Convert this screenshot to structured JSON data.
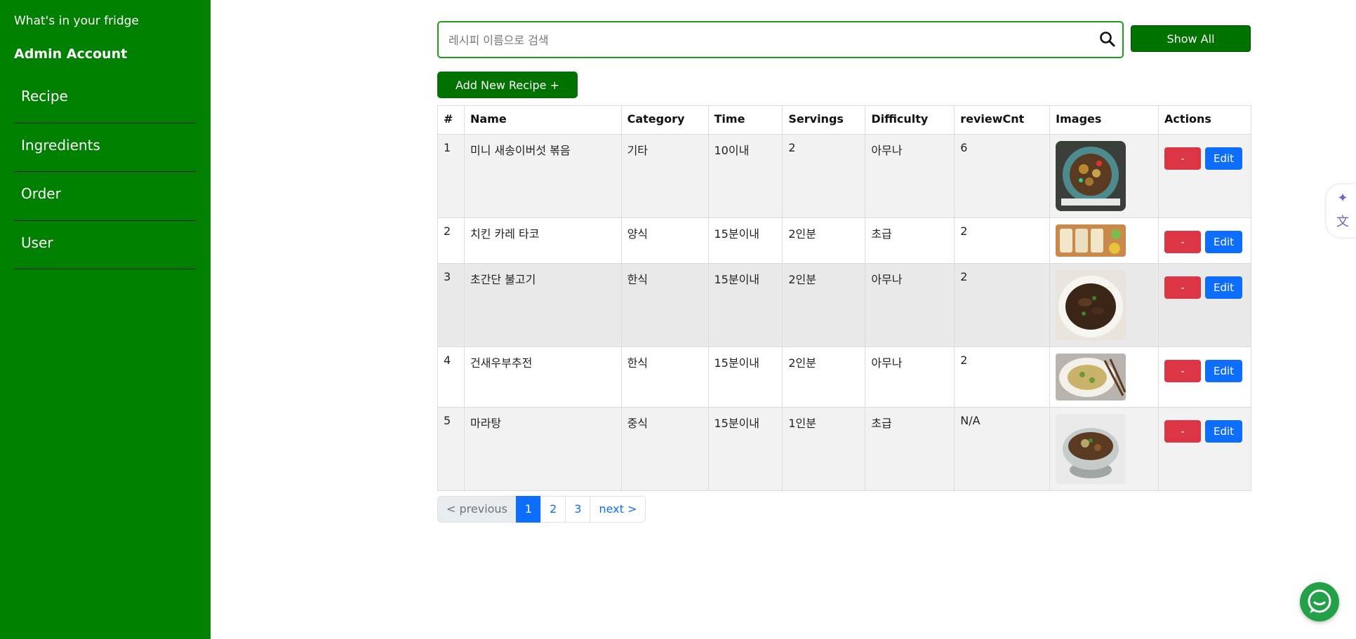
{
  "sidebar": {
    "brand": "What's in your fridge",
    "account": "Admin Account",
    "items": [
      {
        "label": "Recipe"
      },
      {
        "label": "Ingredients"
      },
      {
        "label": "Order"
      },
      {
        "label": "User"
      }
    ]
  },
  "search": {
    "placeholder": "레시피 이름으로 검색",
    "value": "",
    "icon": "search-icon"
  },
  "toolbar": {
    "show_all_label": "Show All",
    "add_label": "Add New Recipe +"
  },
  "table": {
    "columns": [
      "#",
      "Name",
      "Category",
      "Time",
      "Servings",
      "Difficulty",
      "reviewCnt",
      "Images",
      "Actions"
    ],
    "rows": [
      {
        "num": "1",
        "name": "미니 새송이버섯 볶음",
        "category": "기타",
        "time": "10이내",
        "servings": "2",
        "difficulty": "아무나",
        "reviewCnt": "6",
        "image_alt": "미니 새송이버섯 볶음 이미지"
      },
      {
        "num": "2",
        "name": "치킨 카레 타코",
        "category": "양식",
        "time": "15분이내",
        "servings": "2인분",
        "difficulty": "초급",
        "reviewCnt": "2",
        "image_alt": "치킨 카레 타코 이미지"
      },
      {
        "num": "3",
        "name": "초간단 불고기",
        "category": "한식",
        "time": "15분이내",
        "servings": "2인분",
        "difficulty": "아무나",
        "reviewCnt": "2",
        "image_alt": "초간단 불고기 이미지"
      },
      {
        "num": "4",
        "name": "건새우부추전",
        "category": "한식",
        "time": "15분이내",
        "servings": "2인분",
        "difficulty": "아무나",
        "reviewCnt": "2",
        "image_alt": "건새우부추전 이미지"
      },
      {
        "num": "5",
        "name": "마라탕",
        "category": "중식",
        "time": "15분이내",
        "servings": "1인분",
        "difficulty": "초급",
        "reviewCnt": "N/A",
        "image_alt": "마라탕 이미지"
      }
    ],
    "delete_label": "-",
    "edit_label": "Edit"
  },
  "pagination": {
    "prev": "< previous",
    "pages": [
      "1",
      "2",
      "3"
    ],
    "current": "1",
    "next": "next >"
  },
  "colors": {
    "sidebar_bg": "#008000",
    "primary_green": "#007200",
    "delete_red": "#dc3545",
    "edit_blue": "#0d6efd",
    "chat_green": "#24a148"
  }
}
